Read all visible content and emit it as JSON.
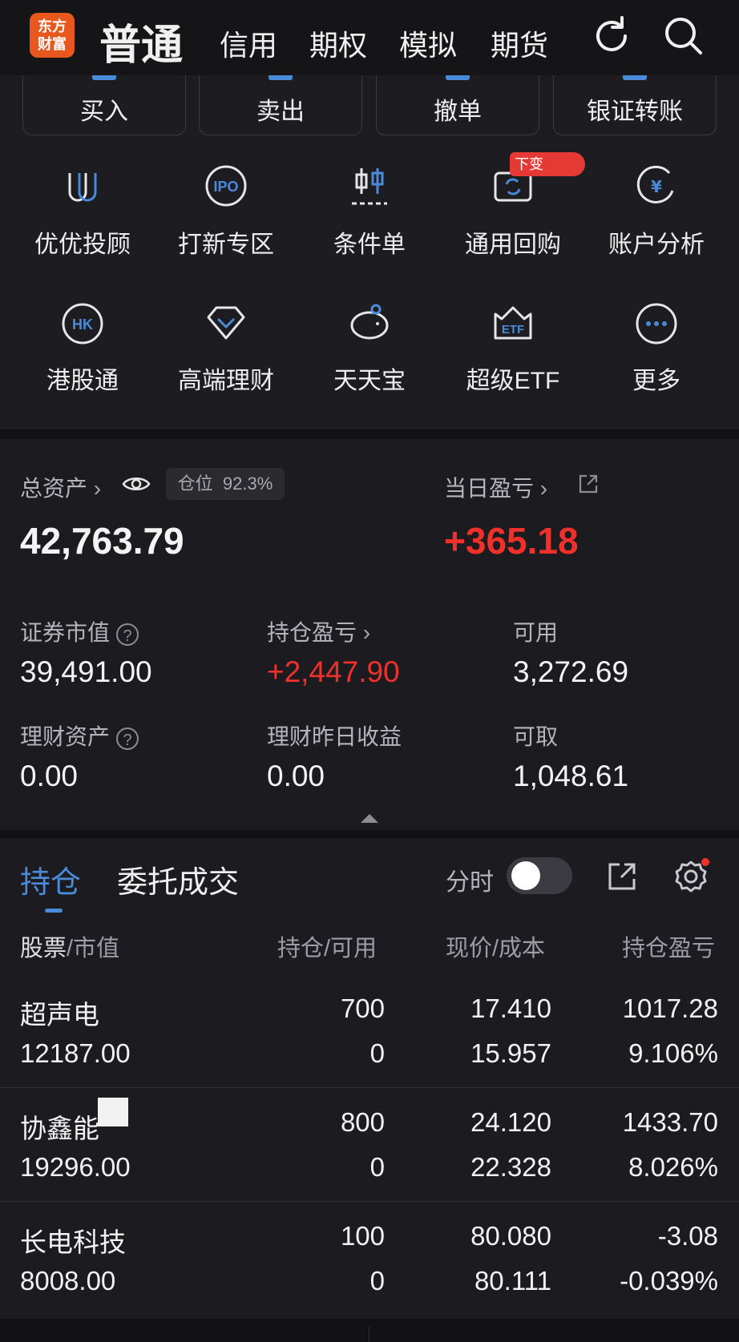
{
  "top_nav": {
    "logo_line1": "东方",
    "logo_line2": "财富",
    "tabs": [
      "普通",
      "信用",
      "期权",
      "模拟",
      "期货"
    ]
  },
  "quick_actions": [
    "买入",
    "卖出",
    "撤单",
    "银证转账"
  ],
  "shortcuts_row1": [
    {
      "label": "优优投顾",
      "icon": "advisor-icon"
    },
    {
      "label": "打新专区",
      "icon": "ipo-icon"
    },
    {
      "label": "条件单",
      "icon": "condition-order-icon"
    },
    {
      "label": "通用回购",
      "icon": "repo-icon"
    },
    {
      "label": "账户分析",
      "icon": "account-analysis-icon"
    }
  ],
  "shortcuts_row2": [
    {
      "label": "港股通",
      "icon": "hk-icon"
    },
    {
      "label": "高端理财",
      "icon": "diamond-icon"
    },
    {
      "label": "天天宝",
      "icon": "piggy-bank-icon"
    },
    {
      "label": "超级ETF",
      "icon": "etf-icon"
    },
    {
      "label": "更多",
      "icon": "more-icon"
    }
  ],
  "badge_text": "下变",
  "assets": {
    "total_label": "总资产",
    "position_label": "仓位",
    "position_pct": "92.3%",
    "total_value": "42,763.79",
    "daily_pl_label": "当日盈亏",
    "daily_pl_value": "+365.18",
    "market_value_label": "证券市值",
    "market_value": "39,491.00",
    "holding_pl_label": "持仓盈亏",
    "holding_pl": "+2,447.90",
    "available_label": "可用",
    "available": "3,272.69",
    "wealth_label": "理财资产",
    "wealth_value": "0.00",
    "wealth_yesterday_label": "理财昨日收益",
    "wealth_yesterday_value": "0.00",
    "withdrawable_label": "可取",
    "withdrawable": "1,048.61"
  },
  "holdings": {
    "tabs": [
      "持仓",
      "委托成交"
    ],
    "time_toggle_label": "分时",
    "headers": [
      "股票",
      "/市值",
      "持仓/可用",
      "现价/成本",
      "持仓盈亏"
    ],
    "rows": [
      {
        "name": "超声电",
        "mkt": "12187.00",
        "qty": "700",
        "avail": "0",
        "price": "17.410",
        "cost": "15.957",
        "pl": "1017.28",
        "pct": "9.106%",
        "color": "red"
      },
      {
        "name": "协鑫能",
        "mkt": "19296.00",
        "qty": "800",
        "avail": "0",
        "price": "24.120",
        "cost": "22.328",
        "pl": "1433.70",
        "pct": "8.026%",
        "color": "red"
      },
      {
        "name": "长电科技",
        "mkt": "8008.00",
        "qty": "100",
        "avail": "0",
        "price": "80.080",
        "cost": "80.111",
        "pl": "-3.08",
        "pct": "-0.039%",
        "color": "green"
      }
    ]
  }
}
